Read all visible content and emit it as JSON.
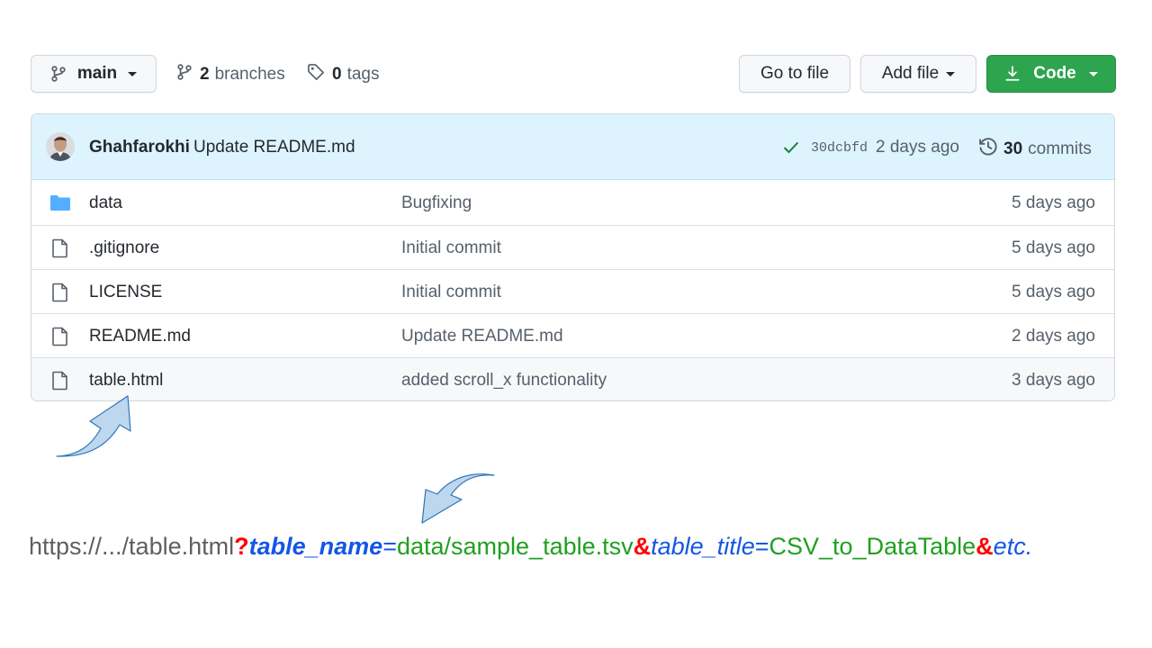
{
  "toolbar": {
    "branch": "main",
    "branches_count": "2",
    "branches_label": "branches",
    "tags_count": "0",
    "tags_label": "tags",
    "go_to_file": "Go to file",
    "add_file": "Add file",
    "code": "Code"
  },
  "latest_commit": {
    "author": "Ghahfarokhi",
    "message": "Update README.md",
    "sha": "30dcbfd",
    "age": "2 days ago",
    "commits_count": "30",
    "commits_label": "commits"
  },
  "files": [
    {
      "name": "data",
      "type": "folder-icon",
      "message": "Bugfixing",
      "age": "5 days ago"
    },
    {
      "name": ".gitignore",
      "type": "file-icon",
      "message": "Initial commit",
      "age": "5 days ago"
    },
    {
      "name": "LICENSE",
      "type": "file-icon",
      "message": "Initial commit",
      "age": "5 days ago"
    },
    {
      "name": "README.md",
      "type": "file-icon",
      "message": "Update README.md",
      "age": "2 days ago"
    },
    {
      "name": "table.html",
      "type": "file-icon",
      "message": "added scroll_x functionality",
      "age": "3 days ago"
    }
  ],
  "url_example": {
    "base": "https://.../table.html",
    "q": "?",
    "key1": "table_name",
    "eq1": "=",
    "val1": "data/sample_table.tsv",
    "amp1": "&",
    "key2": "table_title",
    "eq2": "=",
    "val2": "CSV_to_DataTable",
    "amp2": "&",
    "etc": "etc."
  },
  "colors": {
    "code_button": "#2da44e",
    "header_bg": "#ddf4ff",
    "folder": "#54aeff",
    "arrow_fill": "#bdd7ee",
    "arrow_stroke": "#2e75b6",
    "url_key": "#1556e6",
    "url_value": "#1fa01f",
    "url_separator": "#ff0000"
  }
}
